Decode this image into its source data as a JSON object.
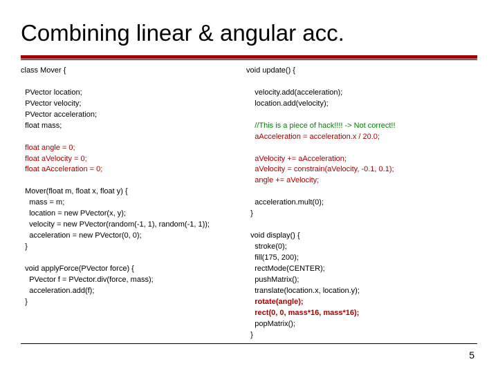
{
  "title": "Combining linear & angular acc.",
  "page_number": "5",
  "left": {
    "l1": "class Mover {",
    "l2": "",
    "l3": "  PVector location;",
    "l4": "  PVector velocity;",
    "l5": "  PVector acceleration;",
    "l6": "  float mass;",
    "l7": "",
    "l8": "  float angle = 0;",
    "l9": "  float aVelocity = 0;",
    "l10": "  float aAcceleration = 0;",
    "l11": "",
    "l12": "  Mover(float m, float x, float y) {",
    "l13": "    mass = m;",
    "l14": "    location = new PVector(x, y);",
    "l15": "    velocity = new PVector(random(-1, 1), random(-1, 1));",
    "l16": "    acceleration = new PVector(0, 0);",
    "l17": "  }",
    "l18": "",
    "l19": "  void applyForce(PVector force) {",
    "l20": "    PVector f = PVector.div(force, mass);",
    "l21": "    acceleration.add(f);",
    "l22": "  }"
  },
  "right": {
    "l1": "void update() {",
    "l2": "",
    "l3": "    velocity.add(acceleration);",
    "l4": "    location.add(velocity);",
    "l5": "",
    "l6": "    //This is a piece of hack!!!! -> Not correct!!",
    "l7": "    aAcceleration = acceleration.x / 20.0;",
    "l8": "",
    "l9": "    aVelocity += aAcceleration;",
    "l10": "    aVelocity = constrain(aVelocity, -0.1, 0.1);",
    "l11": "    angle += aVelocity;",
    "l12": "",
    "l13": "    acceleration.mult(0);",
    "l14": "  }",
    "l15": "",
    "l16": "  void display() {",
    "l17": "    stroke(0);",
    "l18": "    fill(175, 200);",
    "l19": "    rectMode(CENTER);",
    "l20": "    pushMatrix();",
    "l21": "    translate(location.x, location.y);",
    "l22": "    rotate(angle);",
    "l23": "    rect(0, 0, mass*16, mass*16);",
    "l24": "    popMatrix();",
    "l25": "  }"
  }
}
